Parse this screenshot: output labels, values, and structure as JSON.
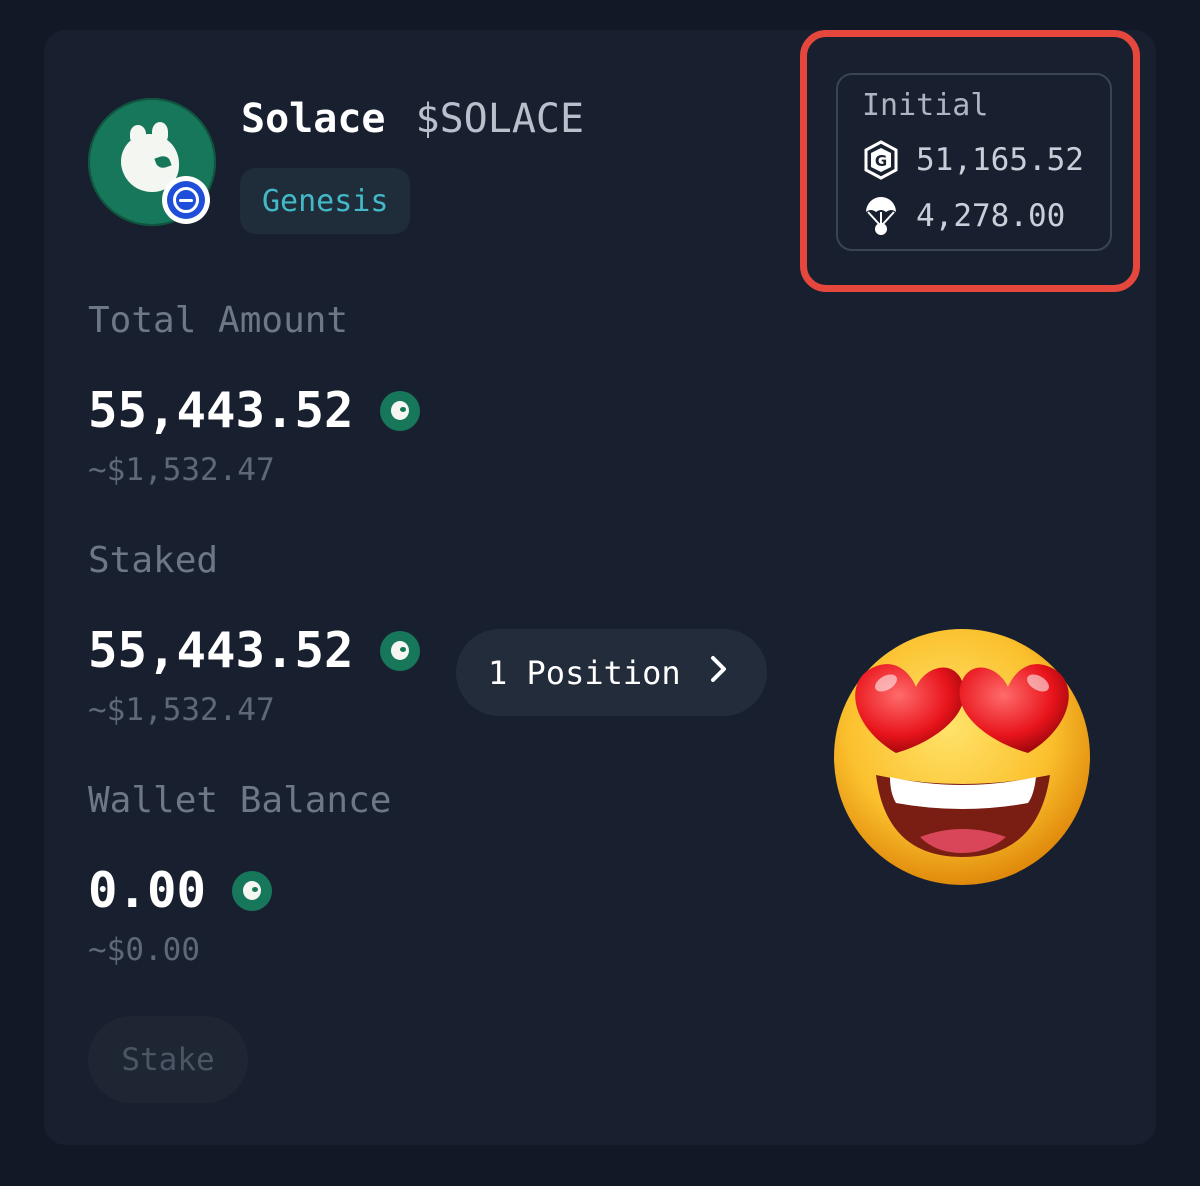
{
  "token": {
    "name": "Solace",
    "ticker": "$SOLACE",
    "tag": "Genesis"
  },
  "initial": {
    "label": "Initial",
    "rows": [
      {
        "icon": "g-logo-icon",
        "value": "51,165.52"
      },
      {
        "icon": "parachute-icon",
        "value": "4,278.00"
      }
    ]
  },
  "total": {
    "label": "Total Amount",
    "value": "55,443.52",
    "usd": "~$1,532.47"
  },
  "staked": {
    "label": "Staked",
    "value": "55,443.52",
    "usd": "~$1,532.47",
    "positions": "1 Position"
  },
  "wallet": {
    "label": "Wallet Balance",
    "value": "0.00",
    "usd": "~$0.00"
  },
  "actions": {
    "stake": "Stake"
  },
  "colors": {
    "background": "#121826",
    "card": "#182030",
    "accent_green": "#17775a",
    "tag_text": "#43b9c7",
    "highlight": "#e5473d"
  }
}
